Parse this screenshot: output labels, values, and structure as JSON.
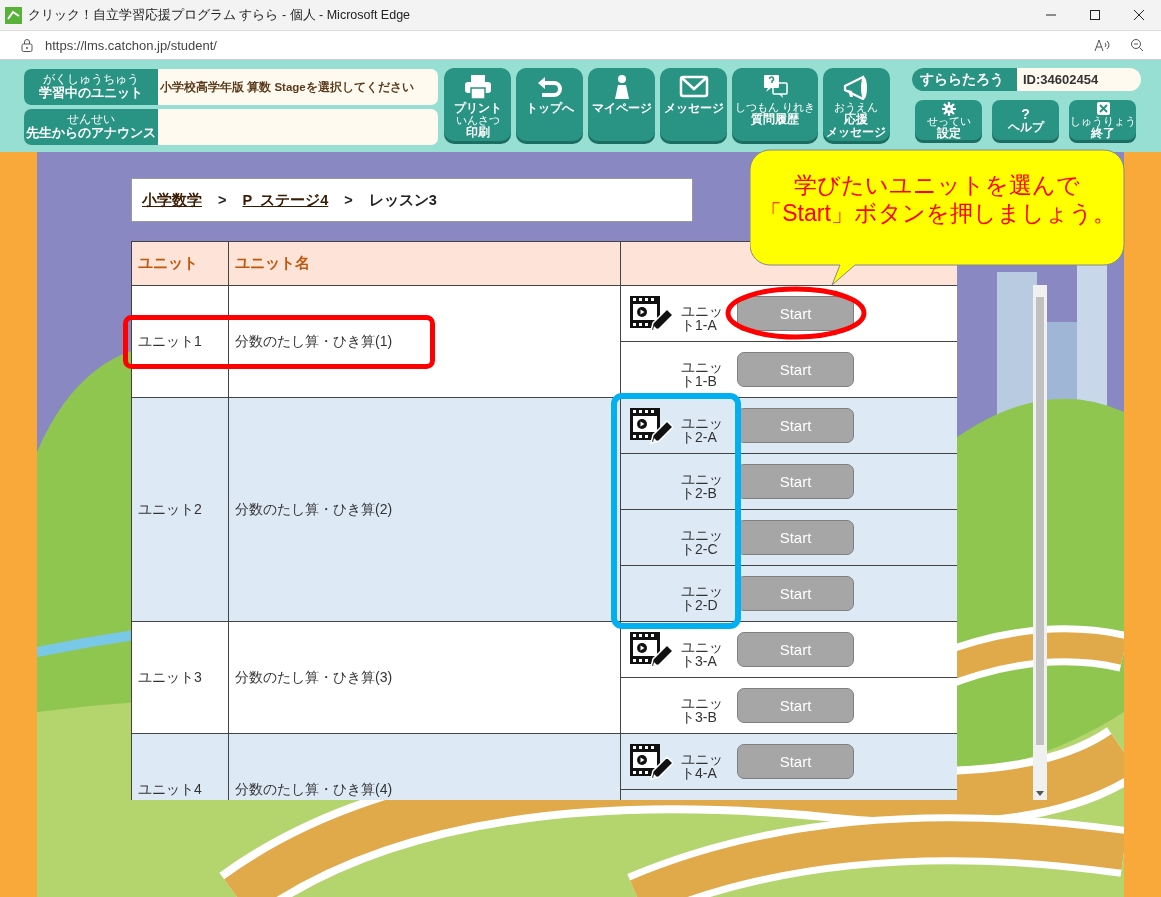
{
  "window": {
    "title": "クリック！自立学習応援プログラム すらら - 個人 - Microsoft Edge"
  },
  "address_bar": {
    "url": "https://lms.catchon.jp/student/"
  },
  "header": {
    "info_rows": [
      {
        "label": "学習中のユニット",
        "ruby": "がくしゅうちゅう",
        "value": "小学校高学年版 算数 Stageを選択してください"
      },
      {
        "label": "先生からのアナウンス",
        "ruby": "せんせい"
      }
    ],
    "nav_buttons": [
      {
        "lines": [
          {
            "text": "プリント",
            "kind": "main"
          },
          {
            "text": "いんさつ",
            "kind": "ruby"
          },
          {
            "text": "印刷",
            "kind": "main"
          }
        ]
      },
      {
        "lines": [
          {
            "text": "トップへ",
            "kind": "main"
          }
        ]
      },
      {
        "lines": [
          {
            "text": "マイページ",
            "kind": "main"
          }
        ]
      },
      {
        "lines": [
          {
            "text": "メッセージ",
            "kind": "main"
          }
        ]
      },
      {
        "lines": [
          {
            "text": "しつもん りれき",
            "kind": "ruby"
          },
          {
            "text": "質問履歴",
            "kind": "main"
          }
        ]
      },
      {
        "lines": [
          {
            "text": "おうえん",
            "kind": "ruby"
          },
          {
            "text": "応援",
            "kind": "main"
          },
          {
            "text": "メッセージ",
            "kind": "main"
          }
        ]
      }
    ],
    "user": {
      "name": "すららたろう",
      "id": "ID:34602454"
    },
    "small_buttons": [
      {
        "lines": [
          {
            "text": "せってい",
            "kind": "ruby"
          },
          {
            "text": "設定",
            "kind": "main"
          }
        ]
      },
      {
        "lines": [
          {
            "text": "?",
            "kind": "glyph"
          },
          {
            "text": "ヘルプ",
            "kind": "main"
          }
        ]
      },
      {
        "lines": [
          {
            "text": "しゅうりょう",
            "kind": "ruby"
          },
          {
            "text": "終了",
            "kind": "main"
          }
        ]
      }
    ]
  },
  "breadcrumb": [
    {
      "text": "小学数学",
      "link": true
    },
    {
      "separator": ">",
      "text": "P_ステージ4",
      "link": true
    },
    {
      "separator": ">",
      "text": "レッスン3",
      "link": false
    }
  ],
  "table": {
    "columns": [
      "ユニット",
      "ユニット名"
    ],
    "rows": [
      {
        "unit": "ユニット1",
        "name": "分数のたし算・ひき算(1)",
        "lessons": [
          {
            "label": "ユニット1-A",
            "video": true,
            "button": "Start"
          },
          {
            "label": "ユニット1-B",
            "video": false,
            "button": "Start"
          }
        ]
      },
      {
        "unit": "ユニット2",
        "name": "分数のたし算・ひき算(2)",
        "lessons": [
          {
            "label": "ユニット2-A",
            "video": true,
            "button": "Start"
          },
          {
            "label": "ユニット2-B",
            "video": false,
            "button": "Start"
          },
          {
            "label": "ユニット2-C",
            "video": false,
            "button": "Start"
          },
          {
            "label": "ユニット2-D",
            "video": false,
            "button": "Start"
          }
        ]
      },
      {
        "unit": "ユニット3",
        "name": "分数のたし算・ひき算(3)",
        "lessons": [
          {
            "label": "ユニット3-A",
            "video": true,
            "button": "Start"
          },
          {
            "label": "ユニット3-B",
            "video": false,
            "button": "Start"
          }
        ]
      },
      {
        "unit": "ユニット4",
        "name": "分数のたし算・ひき算(4)",
        "lessons": [
          {
            "label": "ユニット4-A",
            "video": true,
            "button": "Start"
          },
          {
            "video": false
          }
        ]
      }
    ]
  },
  "callout": {
    "lines": [
      "学びたいユニットを選んで",
      "「Start」ボタンを押しましょう。"
    ]
  }
}
